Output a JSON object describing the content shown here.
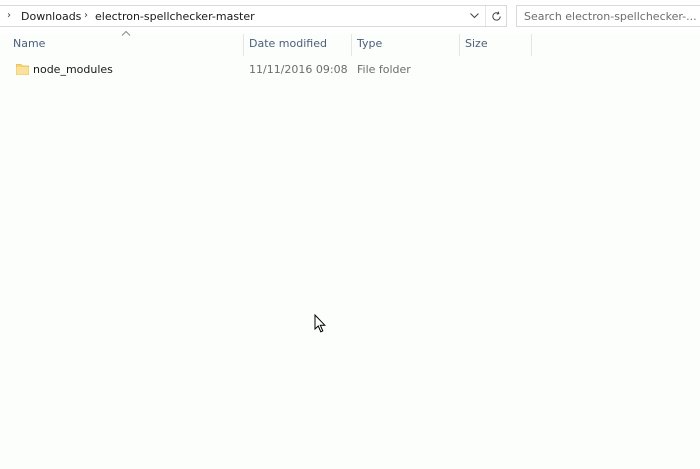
{
  "address_bar": {
    "breadcrumbs": [
      "Downloads",
      "electron-spellchecker-master"
    ]
  },
  "search": {
    "placeholder": "Search electron-spellchecker-..."
  },
  "columns": {
    "name": "Name",
    "date_modified": "Date modified",
    "type": "Type",
    "size": "Size"
  },
  "files": [
    {
      "name": "node_modules",
      "date_modified": "11/11/2016 09:08",
      "type": "File folder",
      "size": "",
      "icon": "folder-icon"
    }
  ],
  "colors": {
    "background": "#fcfefc",
    "header_text": "#4c607a",
    "folder": "#f8d775",
    "border": "#d9d9d9"
  }
}
